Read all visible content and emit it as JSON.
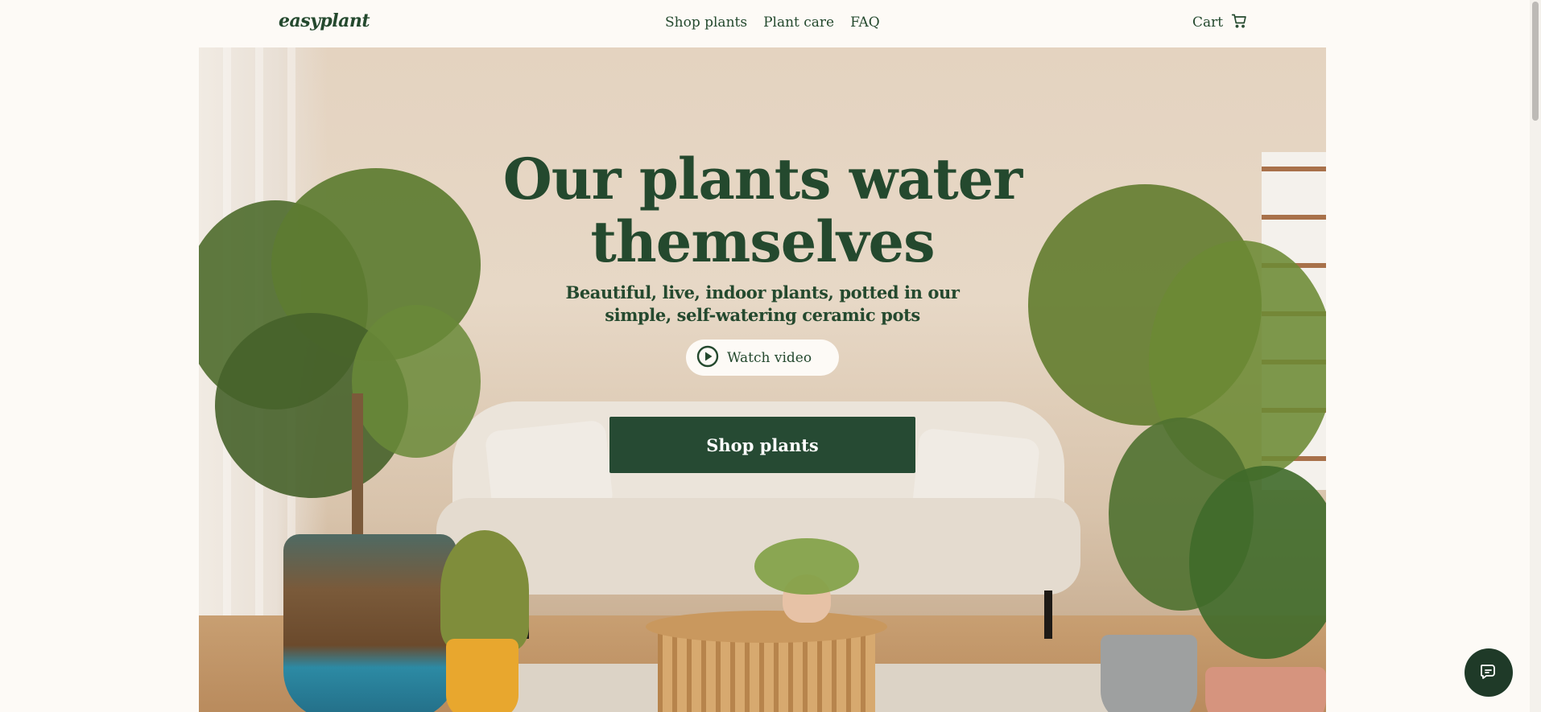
{
  "header": {
    "logo": "easyplant",
    "nav": [
      {
        "label": "Shop plants"
      },
      {
        "label": "Plant care"
      },
      {
        "label": "FAQ"
      }
    ],
    "cart_label": "Cart",
    "cart_icon": "cart-icon"
  },
  "hero": {
    "title_line1": "Our plants water",
    "title_line2": "themselves",
    "subtitle_line1": "Beautiful, live, indoor plants, potted in our",
    "subtitle_line2": "simple, self-watering ceramic pots",
    "watch_label": "Watch video",
    "watch_icon": "play-circle-icon",
    "cta_label": "Shop plants"
  },
  "chat": {
    "icon": "chat-icon"
  },
  "colors": {
    "brand_green": "#24492e",
    "cta_green": "#264a33",
    "page_bg": "#fdfaf6",
    "chat_bg": "#1f3a28"
  }
}
